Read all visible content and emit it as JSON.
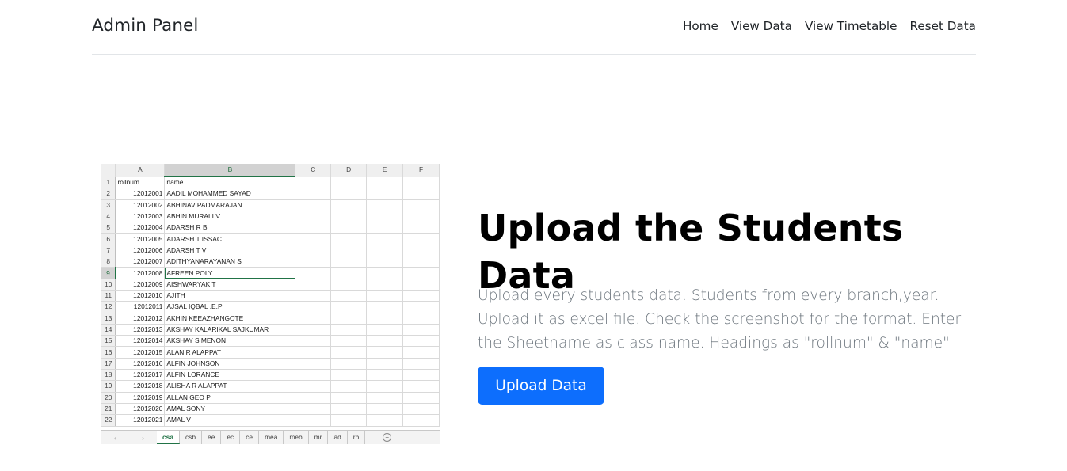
{
  "navbar": {
    "brand": "Admin Panel",
    "links": [
      "Home",
      "View Data",
      "View Timetable",
      "Reset Data"
    ]
  },
  "spreadsheet": {
    "columns": [
      "A",
      "B",
      "C",
      "D",
      "E",
      "F"
    ],
    "header_row": [
      "rollnum",
      "name"
    ],
    "rows": [
      [
        "12012001",
        "AADIL MOHAMMED SAYAD"
      ],
      [
        "12012002",
        "ABHINAV PADMARAJAN"
      ],
      [
        "12012003",
        "ABHIN MURALI V"
      ],
      [
        "12012004",
        "ADARSH R B"
      ],
      [
        "12012005",
        "ADARSH T ISSAC"
      ],
      [
        "12012006",
        "ADARSH T V"
      ],
      [
        "12012007",
        "ADITHYANARAYANAN S"
      ],
      [
        "12012008",
        "AFREEN POLY"
      ],
      [
        "12012009",
        "AISHWARYAK T"
      ],
      [
        "12012010",
        "AJITH"
      ],
      [
        "12012011",
        "AJSAL IQBAL .E.P"
      ],
      [
        "12012012",
        "AKHIN KEEAZHANGOTE"
      ],
      [
        "12012013",
        "AKSHAY KALARIKAL SAJKUMAR"
      ],
      [
        "12012014",
        "AKSHAY S MENON"
      ],
      [
        "12012015",
        "ALAN R ALAPPAT"
      ],
      [
        "12012016",
        "ALFIN JOHNSON"
      ],
      [
        "12012017",
        "ALFIN LORANCE"
      ],
      [
        "12012018",
        "ALISHA R ALAPPAT"
      ],
      [
        "12012019",
        "ALLAN GEO P"
      ],
      [
        "12012020",
        "AMAL SONY"
      ],
      [
        "12012021",
        "AMAL V"
      ]
    ],
    "sheet_tabs": [
      "csa",
      "csb",
      "ee",
      "ec",
      "ce",
      "mea",
      "meb",
      "mr",
      "ad",
      "rb"
    ],
    "active_tab": "csa"
  },
  "hero": {
    "title": "Upload the Students Data",
    "description": "Upload every students data. Students from every branch,year. Upload it as excel file. Check the screenshot for the format. Enter the Sheetname as class name. Headings as \"rollnum\" & \"name\"",
    "button_label": "Upload Data"
  },
  "colors": {
    "primary": "#0d6efd",
    "excel_green": "#217346"
  }
}
